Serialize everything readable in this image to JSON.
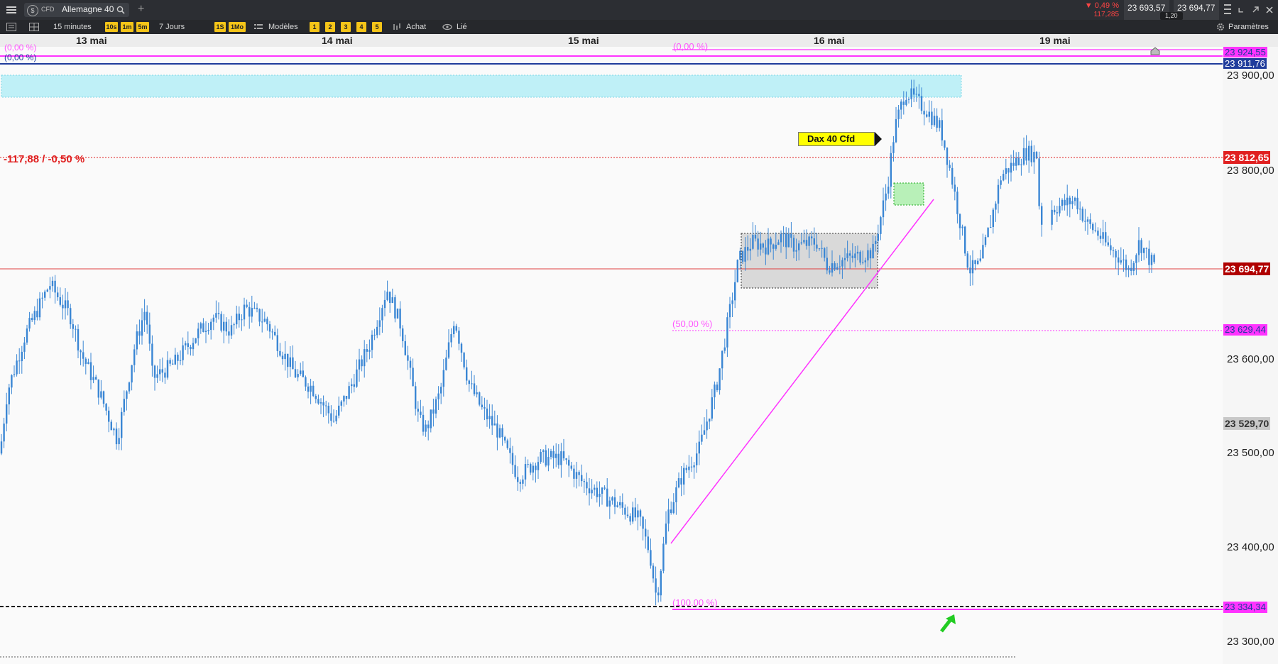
{
  "window": {
    "instrument_type": "CFD",
    "instrument_name": "Allemagne 40",
    "add_tab_symbol": "+",
    "change_pct": "▼ 0,49 %",
    "change_pts": "117,285",
    "sell_price": "23 693,57",
    "buy_price": "23 694,77",
    "spread": "1,20"
  },
  "toolbar": {
    "interval": "15 minutes",
    "quick_intervals": [
      "10s",
      "1m",
      "5m"
    ],
    "period": "7 Jours",
    "quick_periods": [
      "1S",
      "1Mo"
    ],
    "models_label": "Modèles",
    "layout_buttons": [
      "1",
      "2",
      "3",
      "4",
      "5"
    ],
    "buy_label": "Achat",
    "linked_label": "Lié",
    "settings_label": "Paramètres"
  },
  "dates": [
    "13 mai",
    "14 mai",
    "15 mai",
    "16 mai",
    "19 mai"
  ],
  "chart_data": {
    "type": "candlestick",
    "instrument": "Dax 40 Cfd",
    "timeframe": "15 minutes",
    "x": [
      "13 mai",
      "14 mai",
      "15 mai",
      "16 mai",
      "19 mai"
    ],
    "y_ticks": [
      "23 900,00",
      "23 800,00",
      "23 600,00",
      "23 500,00",
      "23 400,00",
      "23 300,00"
    ],
    "ylim": [
      23285,
      23935
    ],
    "label_name": "Dax 40 Cfd",
    "change_text": "-117,88 / -0,50 %",
    "price_tags": [
      {
        "value": "23 924,55",
        "kind": "fib-0"
      },
      {
        "value": "23 911,76",
        "kind": "level"
      },
      {
        "value": "23 812,65",
        "kind": "reference"
      },
      {
        "value": "23 694,77",
        "kind": "current"
      },
      {
        "value": "23 629,44",
        "kind": "fib-50"
      },
      {
        "value": "23 529,70",
        "kind": "marker"
      },
      {
        "value": "23 334,34",
        "kind": "fib-100"
      }
    ],
    "fib_labels": [
      "(0,00 %)",
      "(0,00 %)",
      "(0,00 %)",
      "(50,00 %)",
      "(100,00 %)"
    ],
    "colors": {
      "candle": "#3a86d4",
      "fib": "#ff33ff",
      "level": "#1f3c9c",
      "reference": "#e02020",
      "current": "#c00000",
      "zone": "#bff0f7",
      "consolidation": "#d9d9d9",
      "gap_box": "#b8f0b8",
      "arrow": "#22cc22",
      "label_bg": "#ffff00"
    },
    "waypoints": [
      [
        0,
        23495
      ],
      [
        10,
        23560
      ],
      [
        35,
        23620
      ],
      [
        70,
        23675
      ],
      [
        100,
        23640
      ],
      [
        115,
        23600
      ],
      [
        140,
        23560
      ],
      [
        165,
        23510
      ],
      [
        190,
        23610
      ],
      [
        205,
        23650
      ],
      [
        215,
        23575
      ],
      [
        245,
        23590
      ],
      [
        275,
        23620
      ],
      [
        300,
        23640
      ],
      [
        325,
        23625
      ],
      [
        345,
        23650
      ],
      [
        375,
        23635
      ],
      [
        400,
        23600
      ],
      [
        415,
        23580
      ],
      [
        440,
        23565
      ],
      [
        470,
        23530
      ],
      [
        490,
        23560
      ],
      [
        520,
        23610
      ],
      [
        545,
        23670
      ],
      [
        565,
        23630
      ],
      [
        590,
        23530
      ],
      [
        600,
        23520
      ],
      [
        620,
        23560
      ],
      [
        640,
        23640
      ],
      [
        660,
        23570
      ],
      [
        680,
        23540
      ],
      [
        700,
        23520
      ],
      [
        730,
        23470
      ],
      [
        760,
        23490
      ],
      [
        790,
        23490
      ],
      [
        820,
        23465
      ],
      [
        870,
        23440
      ],
      [
        900,
        23425
      ],
      [
        915,
        23390
      ],
      [
        925,
        23340
      ],
      [
        940,
        23430
      ],
      [
        960,
        23470
      ],
      [
        985,
        23500
      ],
      [
        1010,
        23570
      ],
      [
        1030,
        23655
      ],
      [
        1040,
        23700
      ],
      [
        1060,
        23720
      ],
      [
        1080,
        23715
      ],
      [
        1100,
        23725
      ],
      [
        1120,
        23715
      ],
      [
        1150,
        23720
      ],
      [
        1165,
        23695
      ],
      [
        1185,
        23700
      ],
      [
        1210,
        23705
      ],
      [
        1230,
        23710
      ],
      [
        1250,
        23780
      ],
      [
        1260,
        23840
      ],
      [
        1275,
        23880
      ],
      [
        1290,
        23870
      ],
      [
        1305,
        23860
      ],
      [
        1325,
        23840
      ],
      [
        1340,
        23790
      ],
      [
        1355,
        23730
      ],
      [
        1365,
        23690
      ],
      [
        1380,
        23695
      ],
      [
        1395,
        23740
      ],
      [
        1410,
        23790
      ],
      [
        1430,
        23805
      ],
      [
        1445,
        23815
      ],
      [
        1460,
        23812
      ],
      [
        1465,
        23740
      ],
      [
        1480,
        23755
      ],
      [
        1500,
        23760
      ],
      [
        1515,
        23765
      ],
      [
        1530,
        23740
      ],
      [
        1545,
        23730
      ],
      [
        1560,
        23715
      ],
      [
        1575,
        23705
      ],
      [
        1590,
        23690
      ],
      [
        1605,
        23720
      ],
      [
        1620,
        23700
      ],
      [
        1628,
        23694
      ]
    ]
  }
}
